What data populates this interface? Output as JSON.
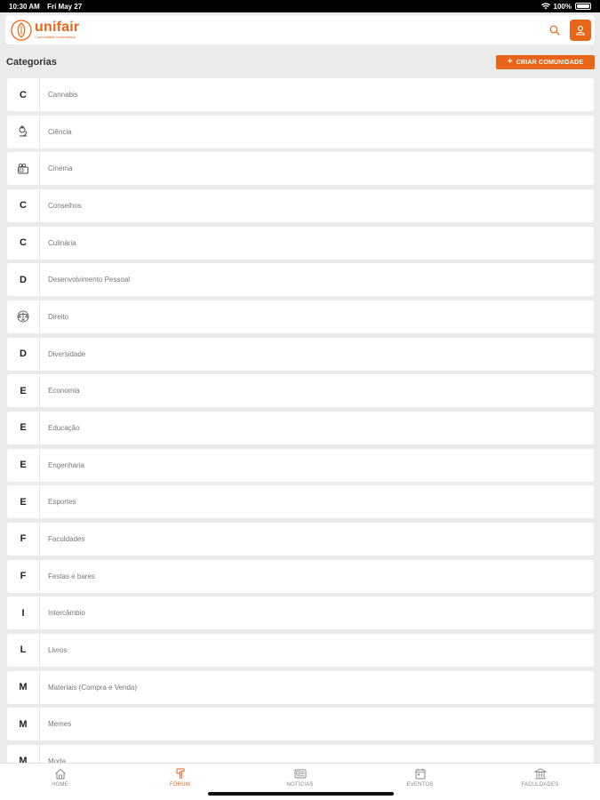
{
  "status_bar": {
    "time": "10:30 AM",
    "date": "Fri May 27",
    "battery": "100%"
  },
  "header": {
    "app_name": "unifair",
    "tagline": "Comunidade Universitária",
    "search_icon": "search-icon",
    "profile_icon": "user-icon"
  },
  "categories": {
    "title": "Categorias",
    "create_label": "CRIAR COMUNIDADE",
    "items": [
      {
        "icon": "C",
        "label": "Cannabis"
      },
      {
        "icon": "science-icon",
        "label": "Ciência"
      },
      {
        "icon": "cinema-icon",
        "label": "Cinema"
      },
      {
        "icon": "C",
        "label": "Conselhos"
      },
      {
        "icon": "C",
        "label": "Culinária"
      },
      {
        "icon": "D",
        "label": "Desenvolvimento Pessoal"
      },
      {
        "icon": "scale-icon",
        "label": "Direito"
      },
      {
        "icon": "D",
        "label": "Diversidade"
      },
      {
        "icon": "E",
        "label": "Economia"
      },
      {
        "icon": "E",
        "label": "Educação"
      },
      {
        "icon": "E",
        "label": "Engenharia"
      },
      {
        "icon": "E",
        "label": "Esportes"
      },
      {
        "icon": "F",
        "label": "Faculdades"
      },
      {
        "icon": "F",
        "label": "Festas e bares"
      },
      {
        "icon": "I",
        "label": "Intercâmbio"
      },
      {
        "icon": "L",
        "label": "Livros"
      },
      {
        "icon": "M",
        "label": "Materiais (Compra e Venda)"
      },
      {
        "icon": "M",
        "label": "Memes"
      },
      {
        "icon": "M",
        "label": "Moda"
      }
    ]
  },
  "tabs": [
    {
      "label": "HOME",
      "icon": "home-icon",
      "active": false
    },
    {
      "label": "FÓRUM",
      "icon": "forum-icon",
      "active": true
    },
    {
      "label": "NOTÍCIAS",
      "icon": "news-icon",
      "active": false
    },
    {
      "label": "EVENTOS",
      "icon": "calendar-icon",
      "active": false
    },
    {
      "label": "FACULDADES",
      "icon": "building-icon",
      "active": false
    }
  ],
  "colors": {
    "accent": "#e8651a",
    "background": "#ebebeb"
  }
}
